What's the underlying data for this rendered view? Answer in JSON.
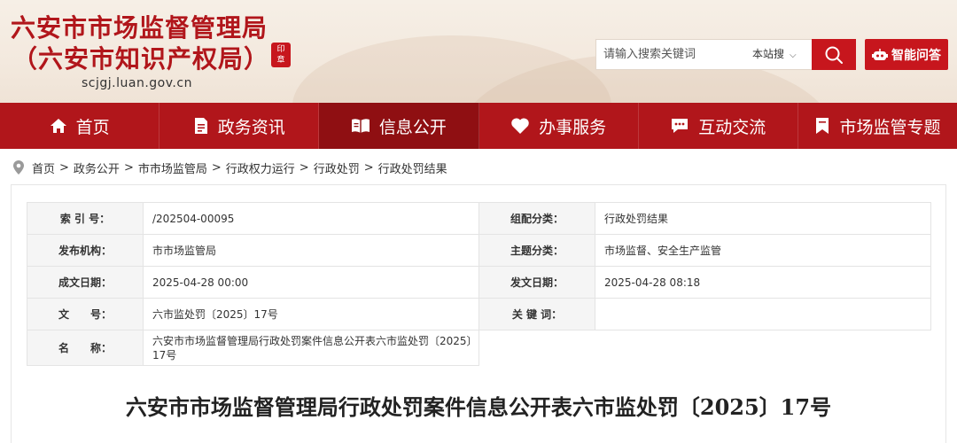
{
  "header": {
    "title_line1": "六安市市场监督管理局",
    "title_line2": "（六安市知识产权局）",
    "domain": "scjgj.luan.gov.cn",
    "search_placeholder": "请输入搜索关键词",
    "search_scope": "本站搜",
    "ai_label": "智能问答"
  },
  "nav": [
    {
      "label": "首页",
      "icon": "home-icon"
    },
    {
      "label": "政务资讯",
      "icon": "document-icon"
    },
    {
      "label": "信息公开",
      "icon": "open-book-icon"
    },
    {
      "label": "办事服务",
      "icon": "heart-icon"
    },
    {
      "label": "互动交流",
      "icon": "chat-icon"
    },
    {
      "label": "市场监管专题",
      "icon": "bookmark-icon"
    }
  ],
  "breadcrumb": [
    "首页",
    "政务公开",
    "市市场监管局",
    "行政权力运行",
    "行政处罚",
    "行政处罚结果"
  ],
  "meta": {
    "index_label": "索 引 号：",
    "index_value": "/202504-00095",
    "category_label": "组配分类：",
    "category_value": "行政处罚结果",
    "publisher_label": "发布机构：",
    "publisher_value": "市市场监管局",
    "topic_label": "主题分类：",
    "topic_value": "市场监督、安全生产监管",
    "created_label": "成文日期：",
    "created_value": "2025-04-28 00:00",
    "published_label": "发文日期：",
    "published_value": "2025-04-28 08:18",
    "docno_label": "文　　号：",
    "docno_value": "六市监处罚〔2025〕17号",
    "keywords_label": "关 键 词：",
    "keywords_value": "",
    "name_label": "名　　称：",
    "name_value": "六安市市场监督管理局行政处罚案件信息公开表六市监处罚〔2025〕17号"
  },
  "document": {
    "title": "六安市市场监督管理局行政处罚案件信息公开表六市监处罚〔2025〕17号"
  },
  "colors": {
    "brand_red": "#b1161b",
    "active_nav": "#8f0f12"
  }
}
